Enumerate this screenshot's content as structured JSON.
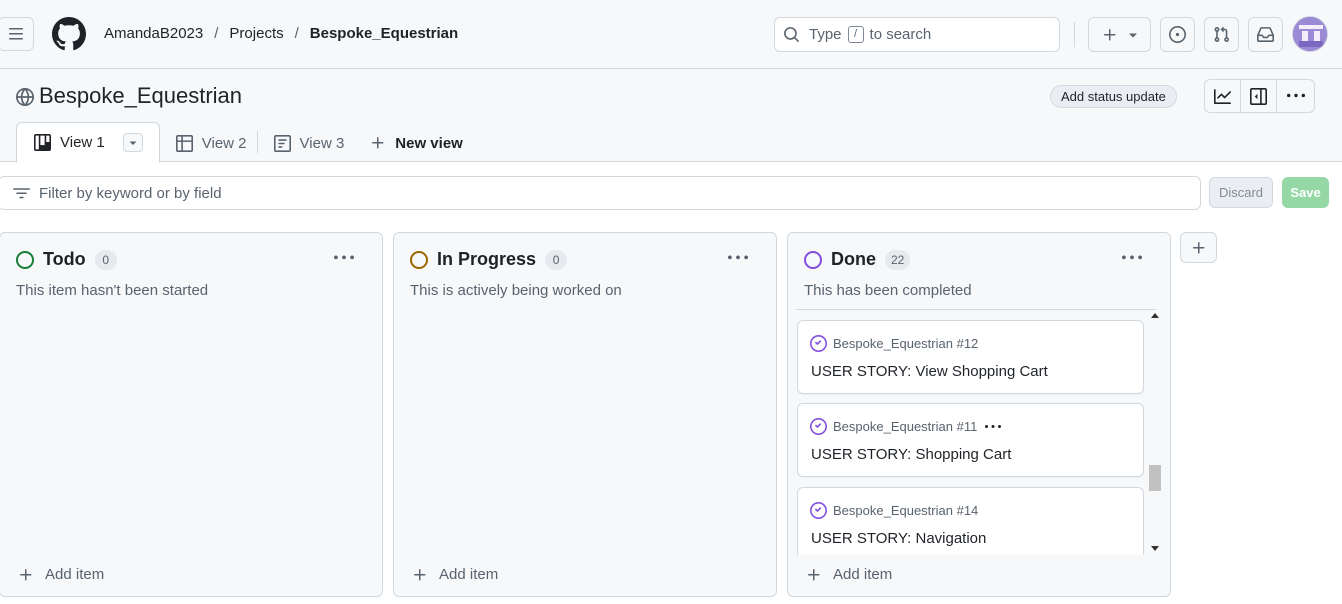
{
  "header": {
    "breadcrumbs": {
      "owner": "AmandaB2023",
      "section": "Projects",
      "project": "Bespoke_Equestrian",
      "separator": "/"
    },
    "search": {
      "prefix": "Type",
      "key": "/",
      "suffix": "to search"
    }
  },
  "project": {
    "title": "Bespoke_Equestrian",
    "status_button": "Add status update",
    "tabs": [
      {
        "label": "View 1",
        "icon": "board-icon",
        "active": true
      },
      {
        "label": "View 2",
        "icon": "table-icon",
        "active": false
      },
      {
        "label": "View 3",
        "icon": "roadmap-icon",
        "active": false
      }
    ],
    "new_view": "New view"
  },
  "filter": {
    "placeholder": "Filter by keyword or by field",
    "discard": "Discard",
    "save": "Save"
  },
  "columns": [
    {
      "name": "Todo",
      "count": "0",
      "description": "This item hasn't been started",
      "color": "#1a7f37",
      "add_item": "Add item"
    },
    {
      "name": "In Progress",
      "count": "0",
      "description": "This is actively being worked on",
      "color": "#9a6700",
      "add_item": "Add item"
    },
    {
      "name": "Done",
      "count": "22",
      "description": "This has been completed",
      "color": "#8250df",
      "add_item": "Add item",
      "cards": [
        {
          "ref": "Bespoke_Equestrian #12",
          "title": "USER STORY: View Shopping Cart"
        },
        {
          "ref": "Bespoke_Equestrian #11",
          "title": "USER STORY: Shopping Cart"
        },
        {
          "ref": "Bespoke_Equestrian #14",
          "title": "USER STORY: Navigation"
        }
      ]
    }
  ],
  "colors": {
    "done_icon": "#8250df",
    "save_button": "#95d8a6",
    "border": "#d1d9e0"
  }
}
